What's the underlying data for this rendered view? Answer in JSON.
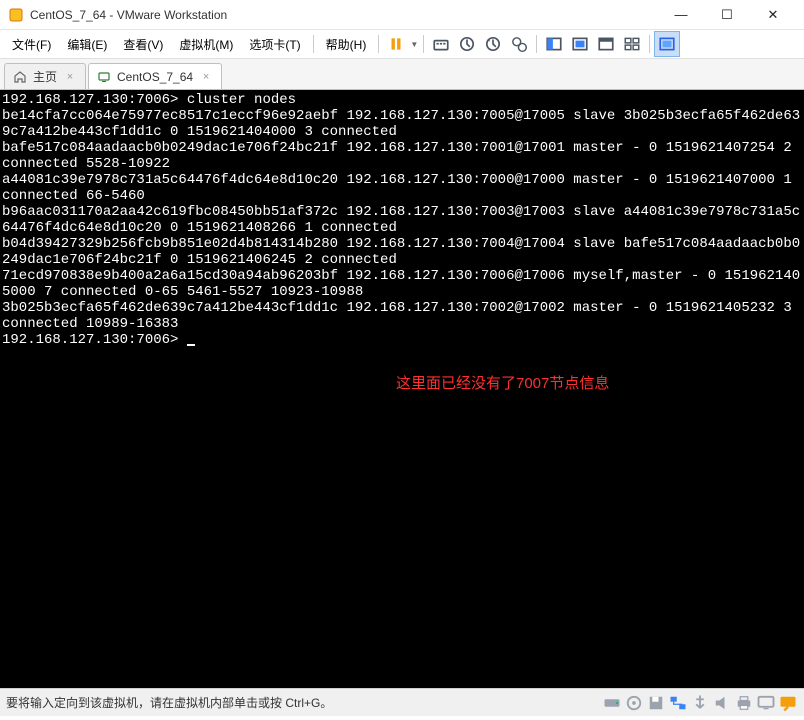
{
  "window": {
    "title": "CentOS_7_64 - VMware Workstation"
  },
  "menu": {
    "file": "文件(F)",
    "edit": "编辑(E)",
    "view": "查看(V)",
    "vm": "虚拟机(M)",
    "tabs": "选项卡(T)",
    "help": "帮助(H)"
  },
  "tabs": {
    "home": "主页",
    "centos": "CentOS_7_64"
  },
  "terminal": {
    "prompt1": "192.168.127.130:7006> ",
    "cmd": "cluster nodes",
    "l1": "be14cfa7cc064e75977ec8517c1eccf96e92aebf 192.168.127.130:7005@17005 slave 3b025b3ecfa65f462de639c7a412be443cf1dd1c 0 1519621404000 3 connected",
    "l2": "bafe517c084aadaacb0b0249dac1e706f24bc21f 192.168.127.130:7001@17001 master - 0 1519621407254 2 connected 5528-10922",
    "l3": "a44081c39e7978c731a5c64476f4dc64e8d10c20 192.168.127.130:7000@17000 master - 0 1519621407000 1 connected 66-5460",
    "l4": "b96aac031170a2aa42c619fbc08450bb51af372c 192.168.127.130:7003@17003 slave a44081c39e7978c731a5c64476f4dc64e8d10c20 0 1519621408266 1 connected",
    "l5": "b04d39427329b256fcb9b851e02d4b814314b280 192.168.127.130:7004@17004 slave bafe517c084aadaacb0b0249dac1e706f24bc21f 0 1519621406245 2 connected",
    "l6": "71ecd970838e9b400a2a6a15cd30a94ab96203bf 192.168.127.130:7006@17006 myself,master - 0 1519621405000 7 connected 0-65 5461-5527 10923-10988",
    "l7": "3b025b3ecfa65f462de639c7a412be443cf1dd1c 192.168.127.130:7002@17002 master - 0 1519621405232 3 connected 10989-16383",
    "prompt2": "192.168.127.130:7006> "
  },
  "annotation": "这里面已经没有了7007节点信息",
  "status": {
    "text": "要将输入定向到该虚拟机，请在虚拟机内部单击或按 Ctrl+G。"
  },
  "icons": {
    "minimize": "—",
    "maximize": "☐",
    "close": "✕"
  }
}
